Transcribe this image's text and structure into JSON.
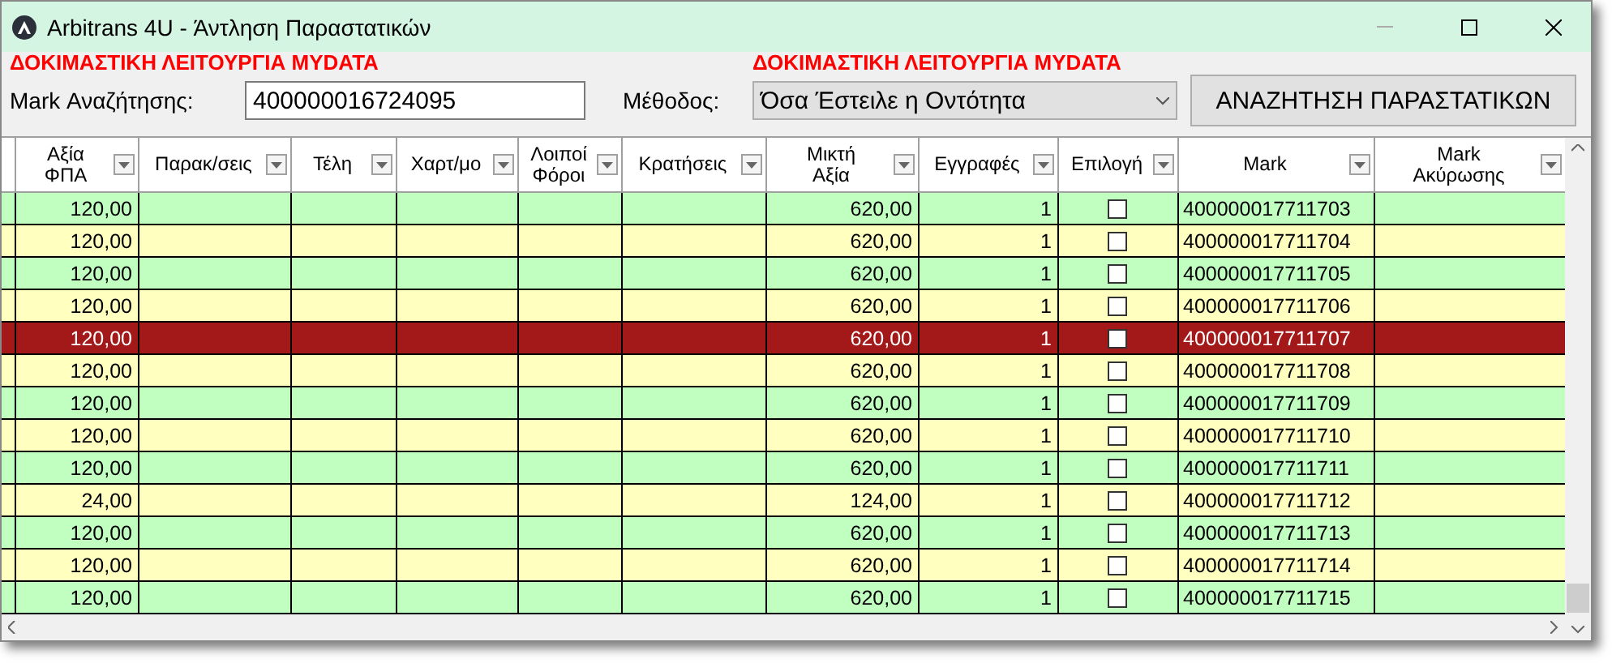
{
  "window": {
    "title": "Arbitrans 4U - Άντληση Παραστατικών"
  },
  "toolbar": {
    "test_mode_labels": [
      "ΔΟΚΙΜΑΣΤΙΚΗ ΛΕΙΤΟΥΡΓΙΑ MYDATA",
      "ΔΟΚΙΜΑΣΤΙΚΗ ΛΕΙΤΟΥΡΓΙΑ MYDATA"
    ],
    "search_label": "Mark Αναζήτησης:",
    "search_value": "400000016724095",
    "method_label": "Μέθοδος:",
    "method_value": "Όσα Έστειλε η Οντότητα",
    "search_button": "ΑΝΑΖΗΤΗΣΗ ΠΑΡΑΣΤΑΤΙΚΩΝ"
  },
  "table": {
    "columns": [
      {
        "label": "Αξία\nΦΠΑ",
        "kind": "vat"
      },
      {
        "label": "Παρακ/σεις",
        "kind": "blank"
      },
      {
        "label": "Τέλη",
        "kind": "blank"
      },
      {
        "label": "Χαρτ/μο",
        "kind": "blank"
      },
      {
        "label": "Λοιποί\nΦόροι",
        "kind": "blank"
      },
      {
        "label": "Κρατήσεις",
        "kind": "blank"
      },
      {
        "label": "Μικτή\nΑξία",
        "kind": "gross"
      },
      {
        "label": "Εγγραφές",
        "kind": "entries"
      },
      {
        "label": "Επιλογή",
        "kind": "check"
      },
      {
        "label": "Mark",
        "kind": "mark"
      },
      {
        "label": "Mark\nΑκύρωσης",
        "kind": "blank"
      }
    ],
    "rows": [
      {
        "vat": "120,00",
        "gross": "620,00",
        "entries": "1",
        "checked": false,
        "mark": "400000017711703",
        "selected": false
      },
      {
        "vat": "120,00",
        "gross": "620,00",
        "entries": "1",
        "checked": false,
        "mark": "400000017711704",
        "selected": false
      },
      {
        "vat": "120,00",
        "gross": "620,00",
        "entries": "1",
        "checked": false,
        "mark": "400000017711705",
        "selected": false
      },
      {
        "vat": "120,00",
        "gross": "620,00",
        "entries": "1",
        "checked": false,
        "mark": "400000017711706",
        "selected": false
      },
      {
        "vat": "120,00",
        "gross": "620,00",
        "entries": "1",
        "checked": false,
        "mark": "400000017711707",
        "selected": true
      },
      {
        "vat": "120,00",
        "gross": "620,00",
        "entries": "1",
        "checked": false,
        "mark": "400000017711708",
        "selected": false
      },
      {
        "vat": "120,00",
        "gross": "620,00",
        "entries": "1",
        "checked": false,
        "mark": "400000017711709",
        "selected": false
      },
      {
        "vat": "120,00",
        "gross": "620,00",
        "entries": "1",
        "checked": false,
        "mark": "400000017711710",
        "selected": false
      },
      {
        "vat": "120,00",
        "gross": "620,00",
        "entries": "1",
        "checked": false,
        "mark": "400000017711711",
        "selected": false
      },
      {
        "vat": "24,00",
        "gross": "124,00",
        "entries": "1",
        "checked": false,
        "mark": "400000017711712",
        "selected": false
      },
      {
        "vat": "120,00",
        "gross": "620,00",
        "entries": "1",
        "checked": false,
        "mark": "400000017711713",
        "selected": false
      },
      {
        "vat": "120,00",
        "gross": "620,00",
        "entries": "1",
        "checked": false,
        "mark": "400000017711714",
        "selected": false
      },
      {
        "vat": "120,00",
        "gross": "620,00",
        "entries": "1",
        "checked": false,
        "mark": "400000017711715",
        "selected": false
      }
    ]
  }
}
